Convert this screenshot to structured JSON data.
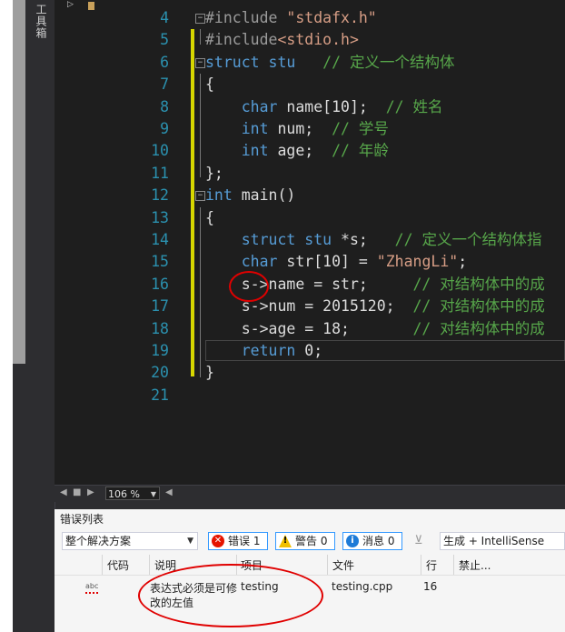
{
  "toolbox": {
    "label": "工具箱"
  },
  "editor": {
    "lines": [
      {
        "n": "4",
        "segs": [
          {
            "c": "pp",
            "t": "#include "
          },
          {
            "c": "str",
            "t": "\"stdafx.h\""
          }
        ]
      },
      {
        "n": "5",
        "segs": [
          {
            "c": "pp",
            "t": "#include"
          },
          {
            "c": "str",
            "t": "<stdio.h>"
          }
        ]
      },
      {
        "n": "6",
        "segs": [
          {
            "c": "kw",
            "t": "struct"
          },
          {
            "c": "",
            "t": " "
          },
          {
            "c": "kw",
            "t": "stu"
          },
          {
            "c": "",
            "t": "   "
          },
          {
            "c": "cm",
            "t": "// 定义一个结构体"
          }
        ]
      },
      {
        "n": "7",
        "segs": [
          {
            "c": "",
            "t": "{"
          }
        ]
      },
      {
        "n": "8",
        "segs": [
          {
            "c": "",
            "t": "    "
          },
          {
            "c": "kw",
            "t": "char"
          },
          {
            "c": "",
            "t": " name[10];  "
          },
          {
            "c": "cm",
            "t": "// 姓名"
          }
        ]
      },
      {
        "n": "9",
        "segs": [
          {
            "c": "",
            "t": "    "
          },
          {
            "c": "kw",
            "t": "int"
          },
          {
            "c": "",
            "t": " num;  "
          },
          {
            "c": "cm",
            "t": "// 学号"
          }
        ]
      },
      {
        "n": "10",
        "segs": [
          {
            "c": "",
            "t": "    "
          },
          {
            "c": "kw",
            "t": "int"
          },
          {
            "c": "",
            "t": " age;  "
          },
          {
            "c": "cm",
            "t": "// 年龄"
          }
        ]
      },
      {
        "n": "11",
        "segs": [
          {
            "c": "",
            "t": "};"
          }
        ]
      },
      {
        "n": "12",
        "segs": [
          {
            "c": "kw",
            "t": "int"
          },
          {
            "c": "",
            "t": " main()"
          }
        ]
      },
      {
        "n": "13",
        "segs": [
          {
            "c": "",
            "t": "{"
          }
        ]
      },
      {
        "n": "14",
        "segs": [
          {
            "c": "",
            "t": "    "
          },
          {
            "c": "kw",
            "t": "struct"
          },
          {
            "c": "",
            "t": " "
          },
          {
            "c": "kw",
            "t": "stu"
          },
          {
            "c": "",
            "t": " *s;   "
          },
          {
            "c": "cm",
            "t": "// 定义一个结构体指"
          }
        ]
      },
      {
        "n": "15",
        "segs": [
          {
            "c": "",
            "t": "    "
          },
          {
            "c": "kw",
            "t": "char"
          },
          {
            "c": "",
            "t": " str[10] = "
          },
          {
            "c": "str",
            "t": "\"ZhangLi\""
          },
          {
            "c": "",
            "t": ";"
          }
        ]
      },
      {
        "n": "16",
        "segs": [
          {
            "c": "",
            "t": "    s->name = str;     "
          },
          {
            "c": "cm",
            "t": "// 对结构体中的成"
          }
        ]
      },
      {
        "n": "17",
        "segs": [
          {
            "c": "",
            "t": "    s->num = 2015120;  "
          },
          {
            "c": "cm",
            "t": "// 对结构体中的成"
          }
        ]
      },
      {
        "n": "18",
        "segs": [
          {
            "c": "",
            "t": "    s->age = 18;       "
          },
          {
            "c": "cm",
            "t": "// 对结构体中的成"
          }
        ]
      },
      {
        "n": "19",
        "segs": [
          {
            "c": "",
            "t": "    "
          },
          {
            "c": "kw",
            "t": "return"
          },
          {
            "c": "",
            "t": " 0;"
          }
        ]
      },
      {
        "n": "20",
        "segs": [
          {
            "c": "",
            "t": "}"
          }
        ]
      },
      {
        "n": "21",
        "segs": []
      }
    ]
  },
  "zoom": {
    "value": "106 %"
  },
  "error_list": {
    "title": "错误列表",
    "scope": "整个解决方案",
    "errors_label": "错误 1",
    "warnings_label": "警告 0",
    "messages_label": "消息 0",
    "build_filter": "生成 + IntelliSense",
    "columns": {
      "code": "代码",
      "description": "说明",
      "project": "项目",
      "file": "文件",
      "line": "行",
      "suppress": "禁止..."
    },
    "rows": [
      {
        "icon_text": "abc",
        "description_line1": "表达式必须是可修",
        "description_line2": "改的左值",
        "project": "testing",
        "file": "testing.cpp",
        "line": "16"
      }
    ]
  },
  "colors": {
    "keyword": "#569cd6",
    "string": "#d69d85",
    "comment": "#57a64a",
    "line_number": "#2b91af",
    "annotation": "#e00000"
  }
}
